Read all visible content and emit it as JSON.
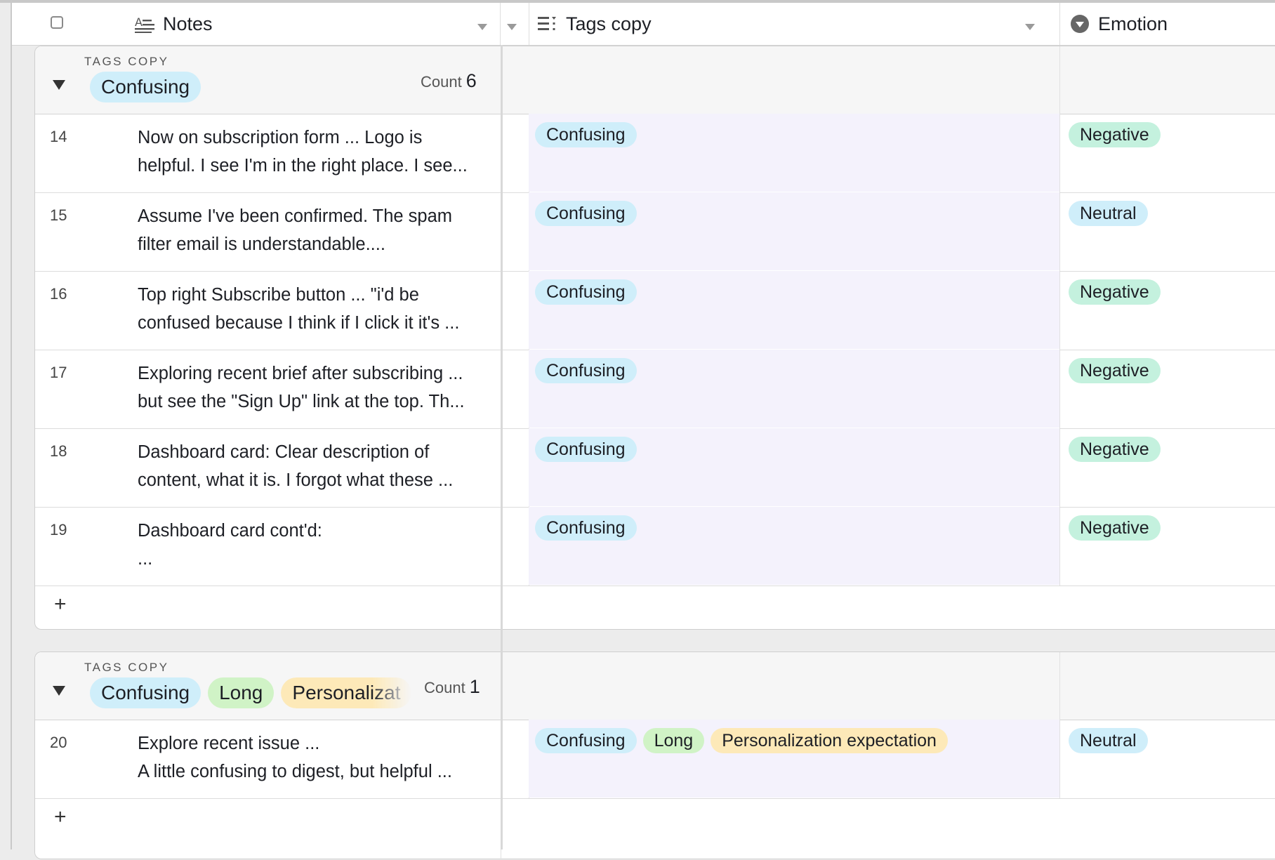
{
  "header": {
    "notes_label": "Notes",
    "tags_label": "Tags copy",
    "emotion_label": "Emotion"
  },
  "groups": [
    {
      "label": "TAGS COPY",
      "tags": [
        "Confusing"
      ],
      "count_label": "Count",
      "count": "6",
      "rows": [
        {
          "num": "14",
          "notes": "Now on subscription form ... Logo is\nhelpful. I see I'm in the right place. I see...",
          "tags": [
            "Confusing"
          ],
          "emotion": "Negative"
        },
        {
          "num": "15",
          "notes": "Assume I've been confirmed. The spam\nfilter email is understandable....",
          "tags": [
            "Confusing"
          ],
          "emotion": "Neutral"
        },
        {
          "num": "16",
          "notes": "Top right Subscribe button ... \"i'd be\nconfused because I think if I click it it's ...",
          "tags": [
            "Confusing"
          ],
          "emotion": "Negative"
        },
        {
          "num": "17",
          "notes": "Exploring recent brief after subscribing ...\nbut see the \"Sign Up\" link at the top. Th...",
          "tags": [
            "Confusing"
          ],
          "emotion": "Negative"
        },
        {
          "num": "18",
          "notes": "Dashboard card: Clear description of\ncontent, what it is. I forgot what these ...",
          "tags": [
            "Confusing"
          ],
          "emotion": "Negative"
        },
        {
          "num": "19",
          "notes": "Dashboard card cont'd:\n...",
          "tags": [
            "Confusing"
          ],
          "emotion": "Negative"
        }
      ]
    },
    {
      "label": "TAGS COPY",
      "tags": [
        "Confusing",
        "Long",
        "Personalizat"
      ],
      "count_label": "Count",
      "count": "1",
      "rows": [
        {
          "num": "20",
          "notes": "Explore recent issue ...\nA little confusing to digest, but helpful ...",
          "tags": [
            "Confusing",
            "Long",
            "Personalization expectation"
          ],
          "emotion": "Neutral"
        }
      ]
    }
  ],
  "add_row_label": "+",
  "colors": {
    "Confusing": "#cfeefa",
    "Long": "#d0f3c6",
    "Personalization expectation": "#fde9b8",
    "Personalizat": "#fde9b8",
    "Negative": "#c4f1de",
    "Neutral": "#cfeefa"
  },
  "icons": [
    "checkbox-icon",
    "long-text-icon",
    "multi-select-icon",
    "single-select-icon",
    "dropdown-caret-icon",
    "collapse-triangle-icon",
    "plus-icon"
  ]
}
